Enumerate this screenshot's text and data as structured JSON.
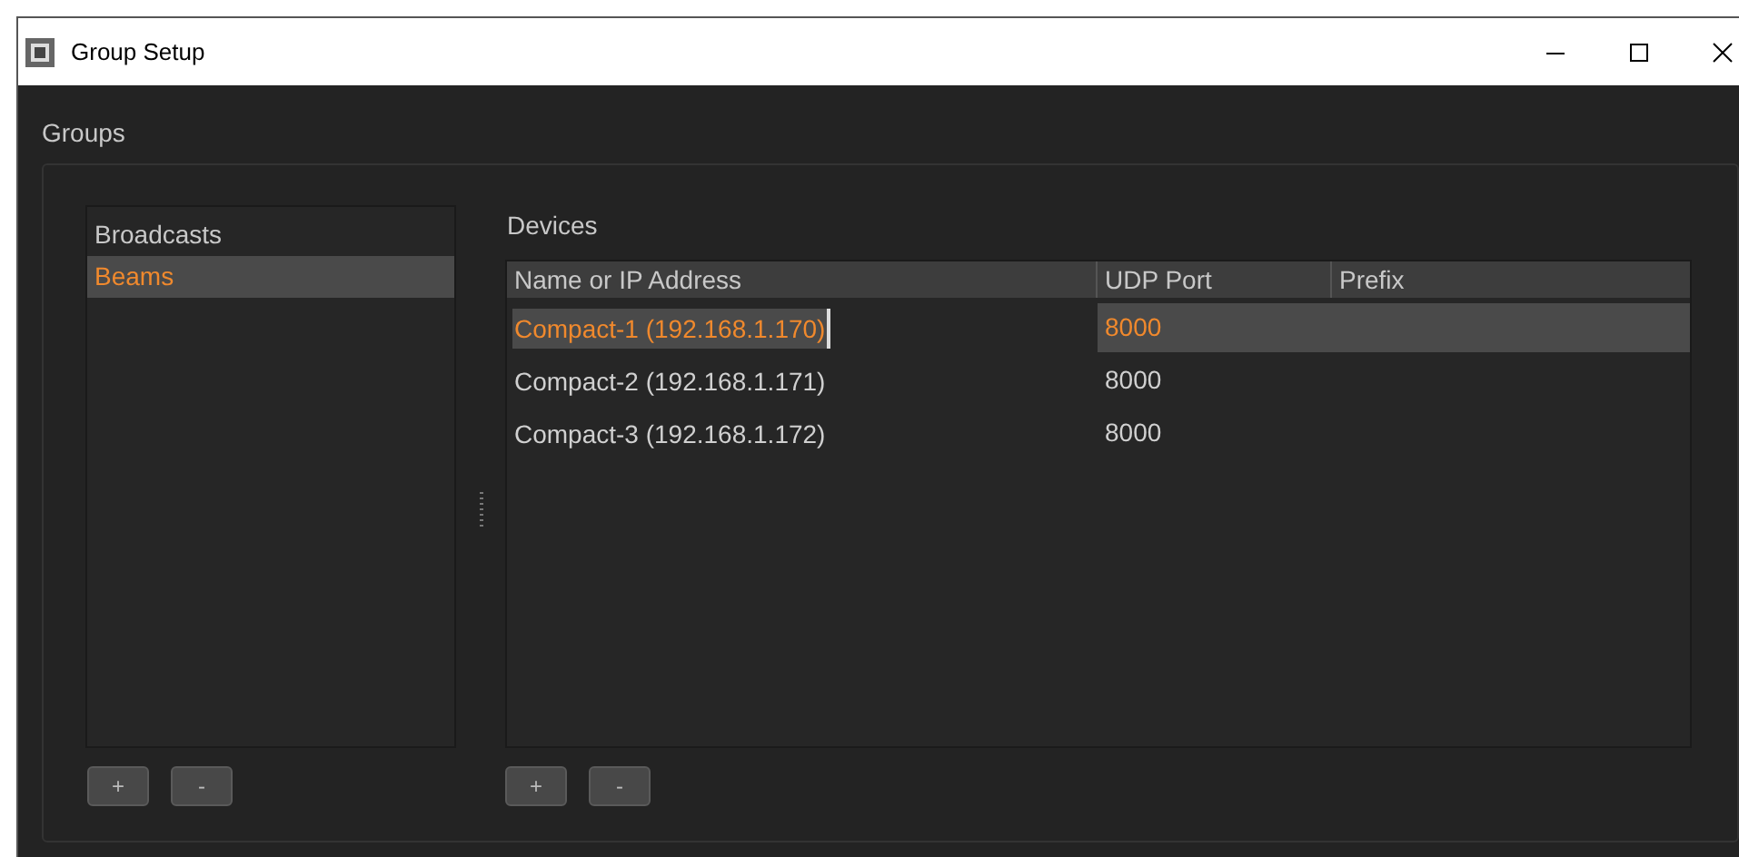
{
  "window": {
    "title": "Group Setup"
  },
  "groups": {
    "label": "Groups",
    "items": [
      {
        "label": "Broadcasts",
        "selected": false
      },
      {
        "label": "Beams",
        "selected": true
      }
    ],
    "buttons": [
      "+",
      "-"
    ]
  },
  "devices": {
    "label": "Devices",
    "columns": [
      "Name or IP Address",
      "UDP Port",
      "Prefix"
    ],
    "rows": [
      {
        "name": "Compact-1 (192.168.1.170)",
        "port": "8000",
        "selected": true
      },
      {
        "name": "Compact-2 (192.168.1.171)",
        "port": "8000",
        "selected": false
      },
      {
        "name": "Compact-3 (192.168.1.172)",
        "port": "8000",
        "selected": false
      }
    ],
    "buttons": [
      "+",
      "-"
    ]
  }
}
